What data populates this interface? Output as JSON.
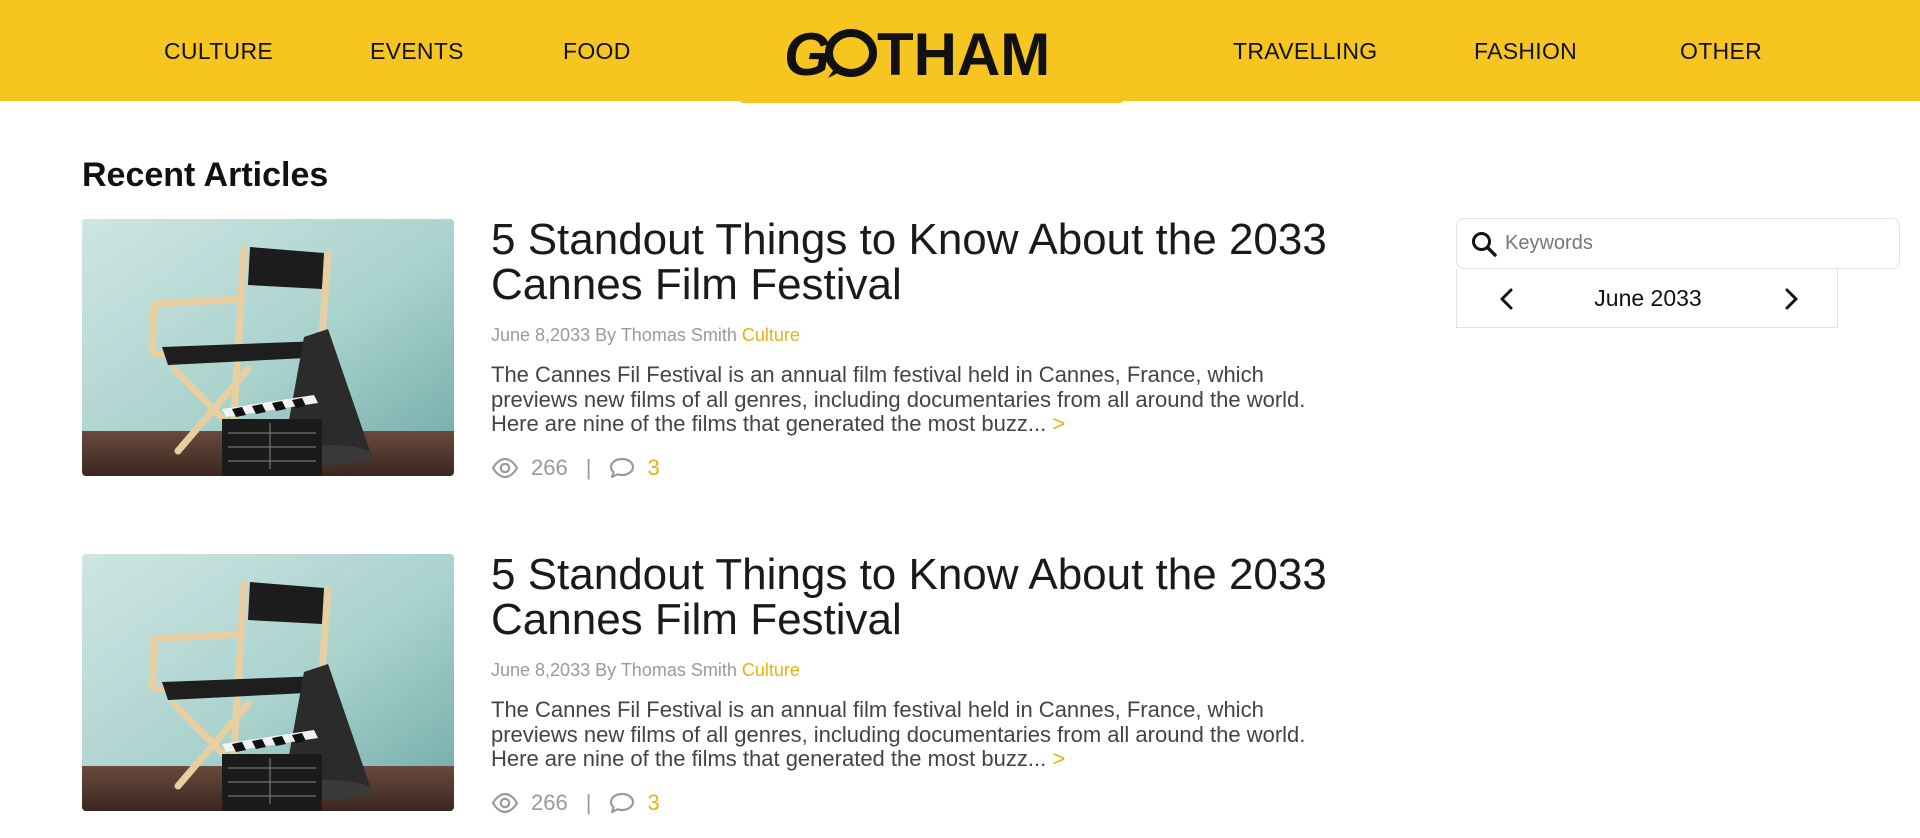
{
  "header": {
    "brand": "GOTHAM",
    "accent_color": "#f6c51f",
    "nav_left": [
      "CULTURE",
      "EVENTS",
      "FOOD"
    ],
    "nav_right": [
      "TRAVELLING",
      "FASHION",
      "OTHER"
    ]
  },
  "main": {
    "section_title": "Recent Articles",
    "articles": [
      {
        "title": "5 Standout Things to Know About the 2033 Cannes Film Festival",
        "date": "June 8,2033",
        "by": "By",
        "author": "Thomas Smith",
        "category": "Culture",
        "excerpt": "The Cannes Fil Festival is an annual film festival held in Cannes, France, which previews new films of all genres, including documentaries from all around the world. Here are nine of the films that generated the most buzz...",
        "read_more": ">",
        "views": "266",
        "separator": "|",
        "comments": "3",
        "image_icon": "director-chair-clapperboard-image"
      },
      {
        "title": "5 Standout Things to Know About the 2033 Cannes Film Festival",
        "date": "June 8,2033",
        "by": "By",
        "author": "Thomas Smith",
        "category": "Culture",
        "excerpt": "The Cannes Fil Festival is an annual film festival held in Cannes, France, which previews new films of all genres, including documentaries from all around the world. Here are nine of the films that generated the most buzz...",
        "read_more": ">",
        "views": "266",
        "separator": "|",
        "comments": "3",
        "image_icon": "director-chair-clapperboard-image"
      }
    ]
  },
  "sidebar": {
    "search": {
      "placeholder": "Keywords",
      "value": "",
      "icon": "search-icon"
    },
    "calendar": {
      "month_label": "June 2033",
      "prev_icon": "chevron-left-icon",
      "next_icon": "chevron-right-icon"
    }
  }
}
